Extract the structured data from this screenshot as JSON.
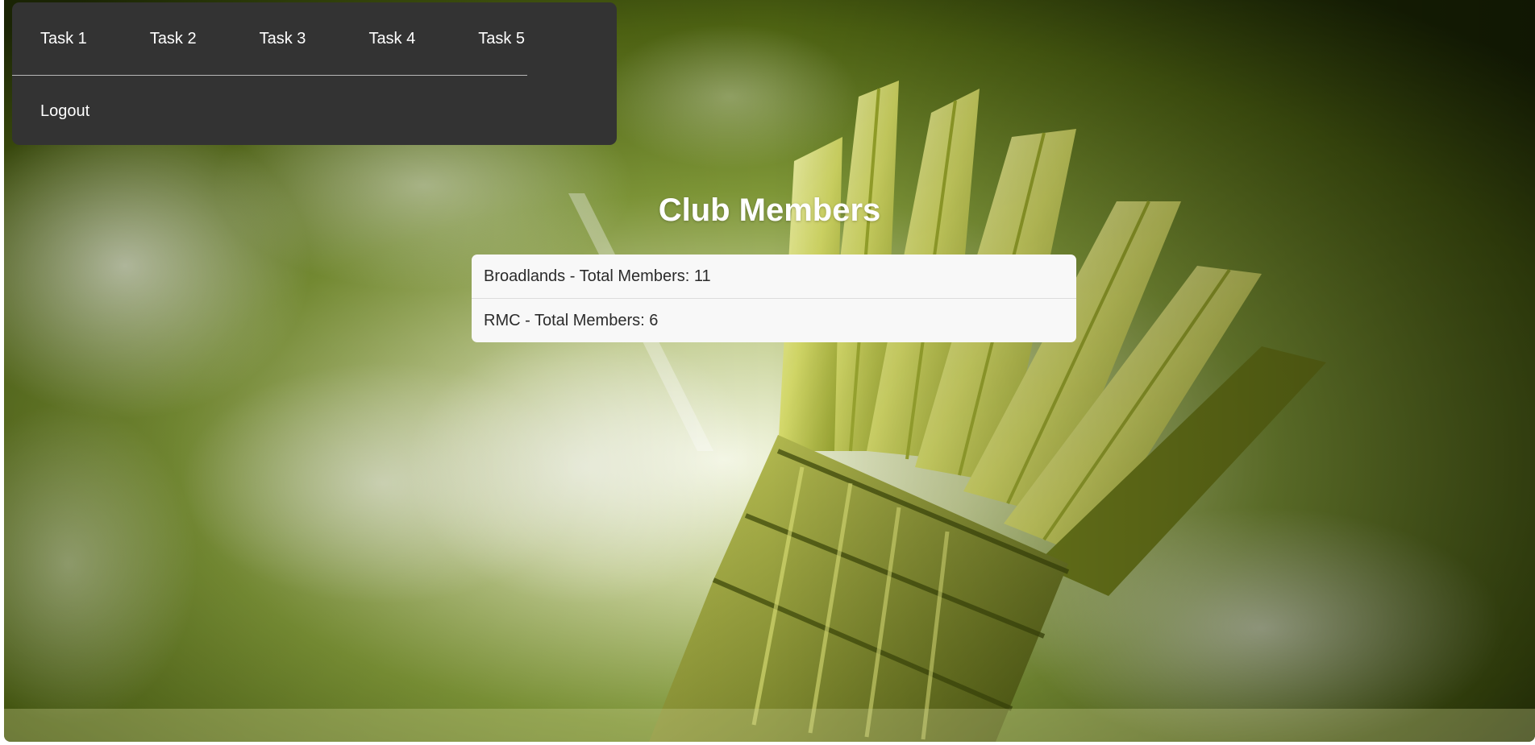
{
  "nav": {
    "tasks": [
      "Task 1",
      "Task 2",
      "Task 3",
      "Task 4",
      "Task 5"
    ],
    "logout": "Logout"
  },
  "page": {
    "title": "Club Members"
  },
  "clubs": [
    {
      "name": "Broadlands",
      "total_members": 11,
      "text": "Broadlands - Total Members: 11"
    },
    {
      "name": "RMC",
      "total_members": 6,
      "text": "RMC - Total Members: 6"
    }
  ],
  "colors": {
    "navbar_bg": "#333333",
    "list_bg": "#f8f8f8",
    "title_text": "#ffffff",
    "backdrop_green": "#5f7a12",
    "shuttlecock_yellow": "#d6dc6a"
  },
  "icons": {
    "background": "badminton-shuttlecock-image"
  }
}
